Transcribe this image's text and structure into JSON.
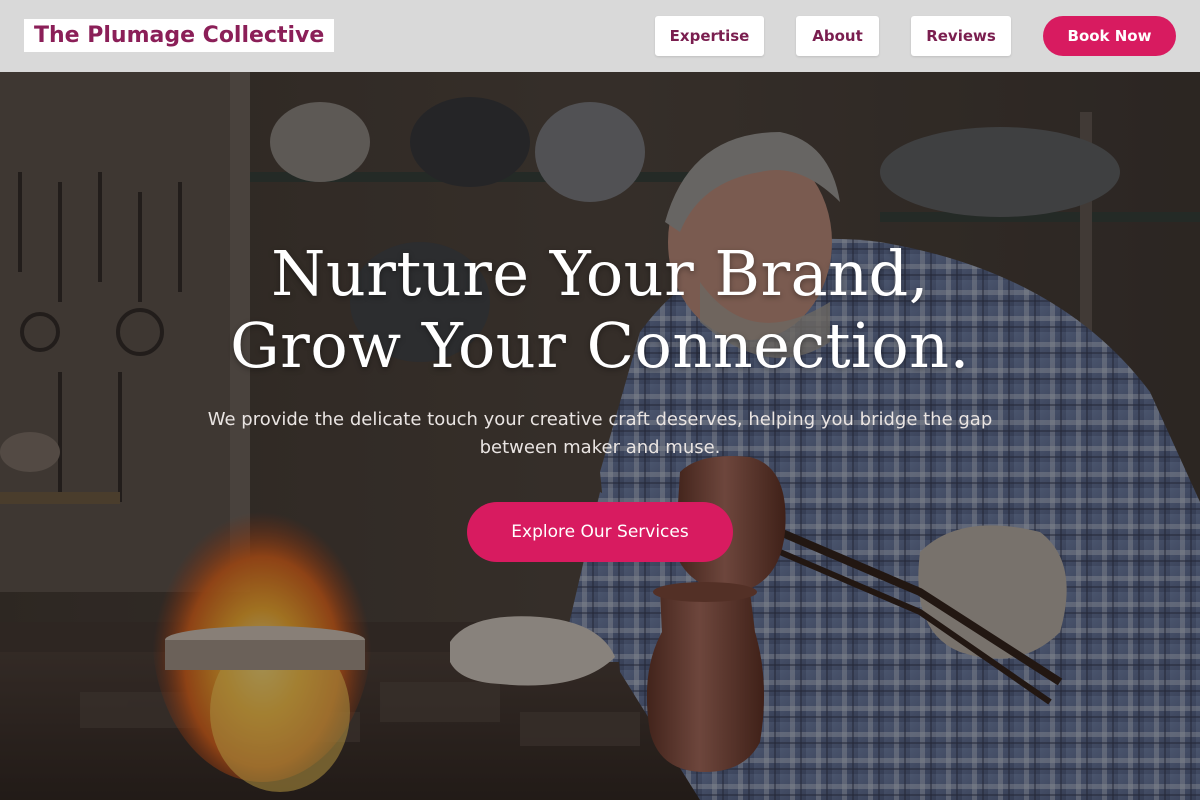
{
  "header": {
    "brand": "The Plumage Collective",
    "nav": [
      {
        "label": "Expertise"
      },
      {
        "label": "About"
      },
      {
        "label": "Reviews"
      }
    ],
    "cta_label": "Book Now"
  },
  "hero": {
    "headline_line1": "Nurture Your Brand,",
    "headline_line2": "Grow Your Connection.",
    "subtitle": "We provide the delicate touch your creative craft deserves, helping you bridge the gap between maker and muse.",
    "cta_label": "Explore Our Services",
    "background_image": "craftsman-metalworker-with-fire"
  },
  "colors": {
    "accent": "#d81b60",
    "brand_text": "#8b1f58",
    "header_bg": "#d9d9d9"
  }
}
